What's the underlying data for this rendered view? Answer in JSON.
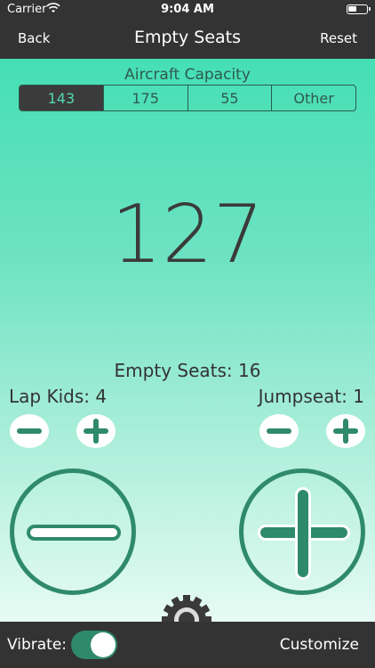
{
  "status": {
    "carrier": "Carrier",
    "time": "9:04 AM"
  },
  "nav": {
    "back": "Back",
    "title": "Empty Seats",
    "reset": "Reset"
  },
  "capacity": {
    "label": "Aircraft Capacity",
    "options": [
      "143",
      "175",
      "55",
      "Other"
    ],
    "selected": "143"
  },
  "counter": {
    "value": "127"
  },
  "empty_seats": "Empty Seats: 16",
  "lap_kids": "Lap Kids: 4",
  "jumpseat": "Jumpseat: 1",
  "bottom": {
    "vibrate_label": "Vibrate:",
    "vibrate_on": true,
    "customize": "Customize"
  },
  "colors": {
    "accent": "#2f8a6b",
    "bar": "#333333",
    "selected_text": "#52d6b0"
  }
}
